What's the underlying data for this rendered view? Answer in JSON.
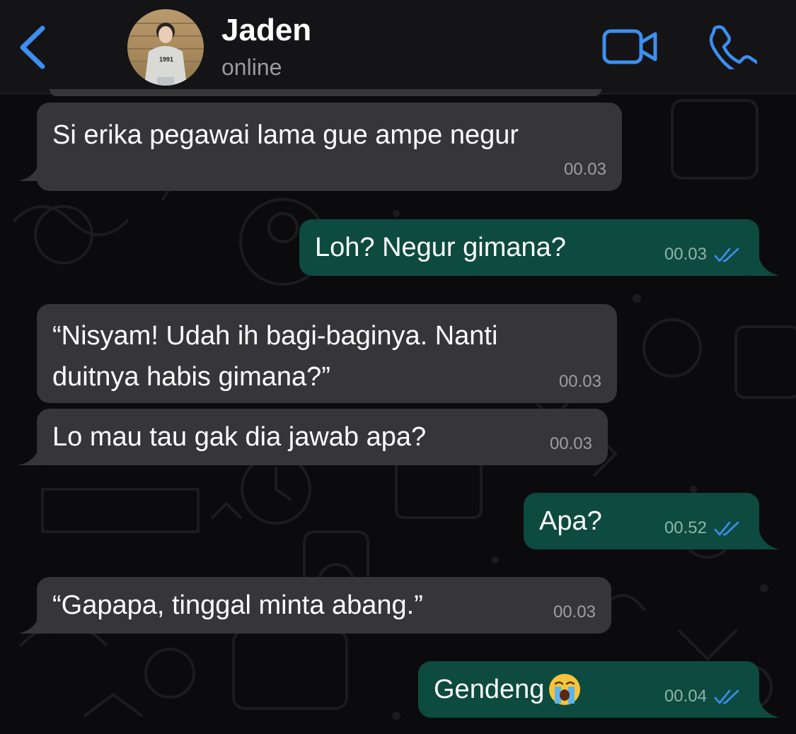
{
  "header": {
    "back_icon": "chevron-left-icon",
    "contact_name": "Jaden",
    "status": "online",
    "avatar_shirt_text": "1991",
    "video_icon": "video-camera-icon",
    "call_icon": "phone-icon",
    "accent": "#3b8ff0"
  },
  "messages": [
    {
      "direction": "incoming",
      "text": "Si erika pegawai lama gue ampe negur",
      "time": "00.03"
    },
    {
      "direction": "outgoing",
      "text": "Loh? Negur gimana?",
      "time": "00.03",
      "read": true
    },
    {
      "direction": "incoming",
      "text": "“Nisyam! Udah ih bagi-baginya. Nanti duitnya habis gimana?”",
      "time": "00.03"
    },
    {
      "direction": "incoming",
      "text": "Lo mau tau gak dia jawab apa?",
      "time": "00.03"
    },
    {
      "direction": "outgoing",
      "text": "Apa?",
      "time": "00.52",
      "read": true
    },
    {
      "direction": "incoming",
      "text": "“Gapapa, tinggal minta abang.”",
      "time": "00.03"
    },
    {
      "direction": "outgoing",
      "text": "Gendeng",
      "emoji": "loudly-crying-face",
      "time": "00.04",
      "read": true
    }
  ],
  "colors": {
    "incoming_bubble": "#363638",
    "outgoing_bubble": "#0d4a3f",
    "read_ticks": "#3b8ff0"
  }
}
